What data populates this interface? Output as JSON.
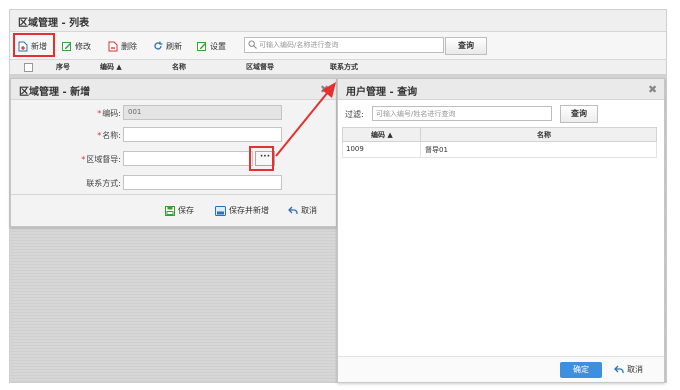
{
  "page": {
    "title": "区域管理 - 列表"
  },
  "toolbar": {
    "add_label": "新增",
    "edit_label": "修改",
    "delete_label": "删除",
    "refresh_label": "刷新",
    "settings_label": "设置",
    "search_placeholder": "可输入编码/名称进行查询",
    "query_label": "查询"
  },
  "grid": {
    "columns": [
      "序号",
      "编码 ▲",
      "名称",
      "区域督导",
      "联系方式"
    ]
  },
  "add_dialog": {
    "title": "区域管理 - 新增",
    "fields": [
      {
        "label": "编码:",
        "value": "001",
        "required": "*"
      },
      {
        "label": "名称:",
        "value": "",
        "required": "*"
      },
      {
        "label": "区域督导:",
        "value": "",
        "required": "*"
      },
      {
        "label": "联系方式:",
        "value": "",
        "required": ""
      }
    ],
    "ellipsis": "···",
    "save_label": "保存",
    "save_new_label": "保存并新增",
    "cancel_label": "取消"
  },
  "user_dialog": {
    "title": "用户管理 - 查询",
    "filter_label": "过滤:",
    "filter_placeholder": "可输入编号/姓名进行查询",
    "query_label": "查询",
    "columns": [
      "编码 ▲",
      "名称"
    ],
    "rows": [
      {
        "code": "1009",
        "name": "督导01"
      }
    ],
    "ok_label": "确定",
    "cancel_label": "取消"
  },
  "colors": {
    "highlight": "#e5302f",
    "primary": "#3d8fe0",
    "icon_green": "#3a9c3a",
    "icon_red": "#d9342b",
    "icon_blue": "#2f6fb6"
  }
}
